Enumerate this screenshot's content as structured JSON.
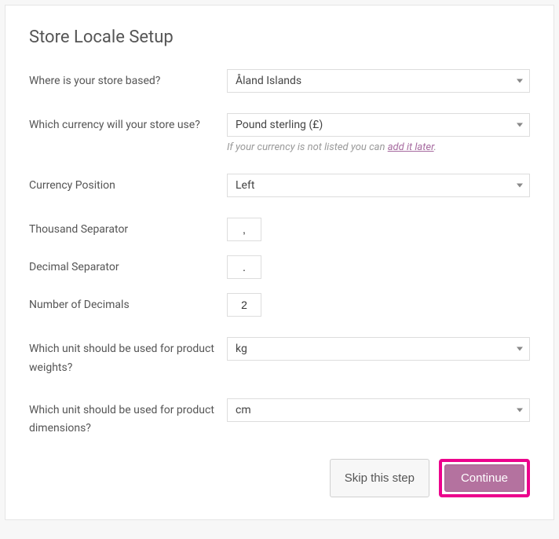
{
  "heading": "Store Locale Setup",
  "fields": {
    "store_based": {
      "label": "Where is your store based?",
      "value": "Åland Islands"
    },
    "currency": {
      "label": "Which currency will your store use?",
      "value": "Pound sterling (£)",
      "hint_prefix": "If your currency is not listed you can ",
      "hint_link": "add it later",
      "hint_suffix": "."
    },
    "currency_position": {
      "label": "Currency Position",
      "value": "Left"
    },
    "thousand_separator": {
      "label": "Thousand Separator",
      "value": ","
    },
    "decimal_separator": {
      "label": "Decimal Separator",
      "value": "."
    },
    "number_decimals": {
      "label": "Number of Decimals",
      "value": "2"
    },
    "weight_unit": {
      "label": "Which unit should be used for product weights?",
      "value": "kg"
    },
    "dimension_unit": {
      "label": "Which unit should be used for product dimensions?",
      "value": "cm"
    }
  },
  "footer": {
    "skip": "Skip this step",
    "continue": "Continue"
  }
}
